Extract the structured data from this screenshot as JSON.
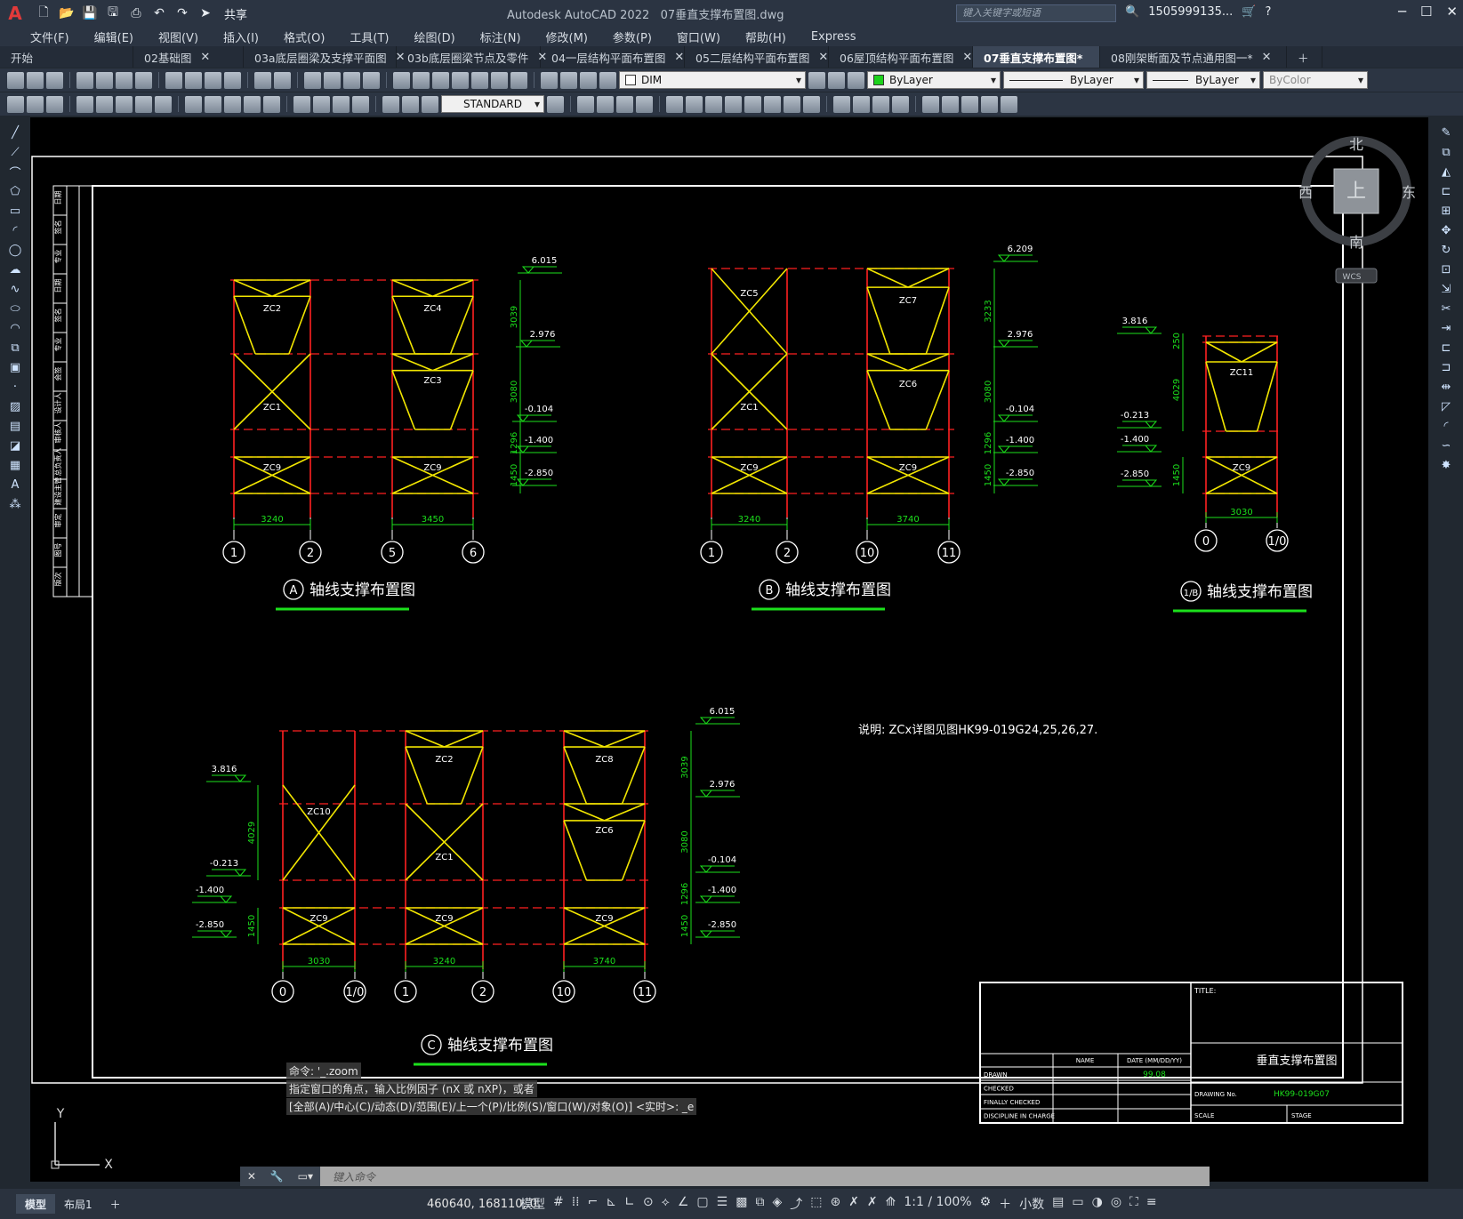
{
  "app": {
    "title": "Autodesk AutoCAD 2022",
    "filename": "07垂直支撑布置图.dwg",
    "share_label": "共享",
    "search_placeholder": "键入关键字或短语",
    "user": "1505999135...",
    "logo": "A"
  },
  "menu": [
    "文件(F)",
    "编辑(E)",
    "视图(V)",
    "插入(I)",
    "格式(O)",
    "工具(T)",
    "绘图(D)",
    "标注(N)",
    "修改(M)",
    "参数(P)",
    "窗口(W)",
    "帮助(H)",
    "Express"
  ],
  "tabs": [
    {
      "label": "开始",
      "active": false,
      "closable": false
    },
    {
      "label": "02基础图",
      "active": false,
      "closable": true
    },
    {
      "label": "03a底层圈梁及支撑平面图",
      "active": false,
      "closable": true
    },
    {
      "label": "03b底层圈梁节点及零件",
      "active": false,
      "closable": true
    },
    {
      "label": "04一层结构平面布置图",
      "active": false,
      "closable": true
    },
    {
      "label": "05二层结构平面布置图",
      "active": false,
      "closable": true
    },
    {
      "label": "06屋顶结构平面布置图",
      "active": false,
      "closable": true
    },
    {
      "label": "07垂直支撑布置图*",
      "active": true,
      "closable": true
    },
    {
      "label": "08刚架断面及节点通用图一*",
      "active": false,
      "closable": true
    }
  ],
  "toolbar": {
    "layer_name": "DIM",
    "color": "ByLayer",
    "linetype": "ByLayer",
    "lineweight": "ByLayer",
    "plotstyle": "ByColor",
    "text_style": "STANDARD"
  },
  "viewcube": {
    "north": "北",
    "south": "南",
    "east": "东",
    "west": "西",
    "top": "上",
    "wcs": "WCS"
  },
  "drawing": {
    "colors": {
      "frame": "#ffffff",
      "column": "#ff2020",
      "brace": "#f2e600",
      "dim": "#1ce01c",
      "text": "#ffffff"
    },
    "note": "说明: ZCx详图见图HK99-019G24,25,26,27.",
    "views": [
      {
        "title_mark": "A",
        "title": "轴线支撑布置图",
        "axes": [
          "1",
          "2",
          "5",
          "6"
        ],
        "spans": [
          "3240",
          "3450"
        ],
        "levels": [
          "6.015",
          "2.976",
          "-0.104",
          "-1.400",
          "-2.850"
        ],
        "vdims": [
          "3039",
          "3080",
          "1296",
          "1450"
        ],
        "braces": [
          "ZC2",
          "ZC1",
          "ZC9",
          "ZC4",
          "ZC3",
          "ZC9"
        ]
      },
      {
        "title_mark": "B",
        "title": "轴线支撑布置图",
        "axes": [
          "1",
          "2",
          "10",
          "11"
        ],
        "spans": [
          "3240",
          "3740"
        ],
        "levels": [
          "6.209",
          "2.976",
          "-0.104",
          "-1.400",
          "-2.850"
        ],
        "vdims": [
          "3233",
          "3080",
          "1296",
          "1450"
        ],
        "braces": [
          "ZC5",
          "ZC1",
          "ZC9",
          "ZC7",
          "ZC6",
          "ZC9"
        ]
      },
      {
        "title_mark": "1/B",
        "title": "轴线支撑布置图",
        "axes": [
          "0",
          "1/0"
        ],
        "spans": [
          "3030"
        ],
        "levels": [
          "3.816",
          "-0.213",
          "-1.400",
          "-2.850"
        ],
        "vdims": [
          "250",
          "4029",
          "1450"
        ],
        "braces": [
          "ZC11",
          "ZC9"
        ]
      },
      {
        "title_mark": "C",
        "title": "轴线支撑布置图",
        "axes": [
          "0",
          "1/0",
          "1",
          "2",
          "10",
          "11"
        ],
        "spans": [
          "3030",
          "3240",
          "3740"
        ],
        "levels_left": [
          "3.816",
          "-0.213",
          "-1.400",
          "-2.850"
        ],
        "levels_right": [
          "6.015",
          "2.976",
          "-0.104",
          "-1.400",
          "-2.850"
        ],
        "vdims_left": [
          "4029",
          "1450"
        ],
        "vdims_right": [
          "3039",
          "3080",
          "1296",
          "1450"
        ],
        "braces": [
          "ZC10",
          "ZC9",
          "ZC2",
          "ZC1",
          "ZC9",
          "ZC8",
          "ZC6",
          "ZC9"
        ]
      }
    ],
    "title_block": {
      "title_label": "TITLE:",
      "title": "垂直支撑布置图",
      "name_label": "NAME",
      "date_label": "DATE (MM/DD/YY)",
      "rows": [
        "DRAWN",
        "CHECKED",
        "FINALLY CHECKED",
        "DISCIPLINE IN CHARGE"
      ],
      "drawn_date": "99.08",
      "drawing_no_label": "DRAWING No.",
      "drawing_no": "HK99-019G07",
      "scale_label": "SCALE",
      "stage_label": "STAGE"
    },
    "left_block_labels": [
      "日期",
      "签名",
      "专业",
      "日期",
      "签名",
      "专业",
      "会签",
      "设计人",
      "审核人",
      "总负责人",
      "建设主管",
      "审定",
      "图号",
      "版次"
    ]
  },
  "command": {
    "history": [
      "命令: '_.zoom",
      "指定窗口的角点，输入比例因子 (nX 或 nXP)，或者",
      "[全部(A)/中心(C)/动态(D)/范围(E)/上一个(P)/比例(S)/窗口(W)/对象(O)] <实时>: _e"
    ],
    "placeholder": "键入命令"
  },
  "status": {
    "layout_tabs": [
      "模型",
      "布局1"
    ],
    "coords": "460640, 168110, 0",
    "model_label": "模型",
    "scale": "1:1 / 100%",
    "units": "小数"
  }
}
